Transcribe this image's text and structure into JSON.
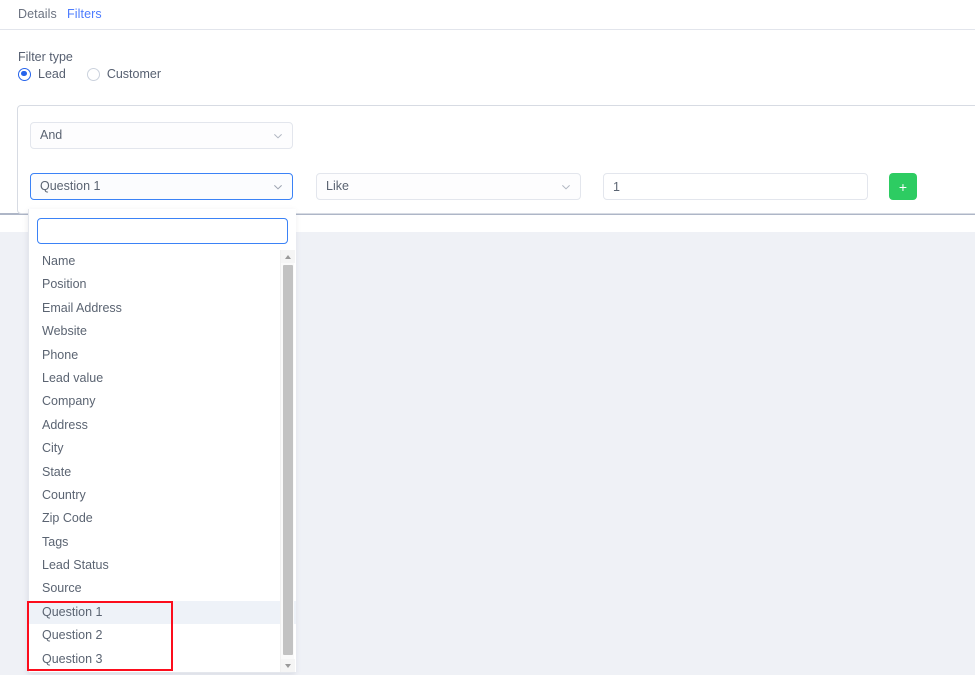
{
  "tabs": [
    {
      "label": "Details",
      "active": false
    },
    {
      "label": "Filters",
      "active": true
    }
  ],
  "filter_type": {
    "label": "Filter type",
    "options": [
      {
        "label": "Lead",
        "checked": true
      },
      {
        "label": "Customer",
        "checked": false
      }
    ]
  },
  "filter_row": {
    "conjunction": {
      "value": "And"
    },
    "field": {
      "value": "Question 1",
      "focused": true
    },
    "operator": {
      "value": "Like"
    },
    "value_input": {
      "value": "1",
      "placeholder": ""
    },
    "add_button": {
      "label": "+"
    }
  },
  "dropdown": {
    "search": {
      "value": "",
      "placeholder": ""
    },
    "items": [
      "Name",
      "Position",
      "Email Address",
      "Website",
      "Phone",
      "Lead value",
      "Company",
      "Address",
      "City",
      "State",
      "Country",
      "Zip Code",
      "Tags",
      "Lead Status",
      "Source",
      "Question 1",
      "Question 2",
      "Question 3"
    ],
    "active_item": "Question 1"
  },
  "colors": {
    "accent_blue": "#4d7cfe",
    "focus_blue": "#3b82f6",
    "radio_blue": "#2563eb",
    "add_green": "#2dcc62",
    "annotation_red": "#fc0d1c",
    "page_bg": "#eff1f6",
    "highlight_row": "#eef2f8"
  }
}
